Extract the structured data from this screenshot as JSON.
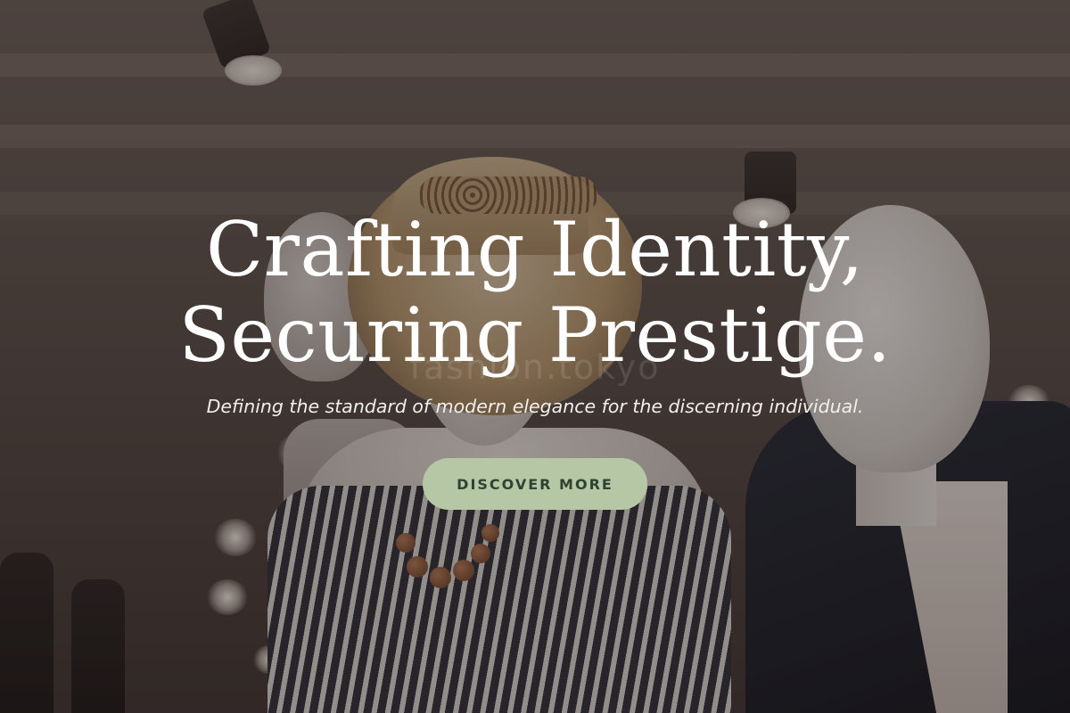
{
  "hero": {
    "headline_line1": "Crafting Identity,",
    "headline_line2": "Securing Prestige.",
    "subtitle": "Defining the standard of modern elegance for the discerning individual.",
    "cta_label": "DISCOVER MORE",
    "watermark": "fashion.tokyo"
  },
  "colors": {
    "cta_background": "#b6c7a6",
    "cta_text": "#2f4332",
    "headline_text": "#ffffff"
  }
}
